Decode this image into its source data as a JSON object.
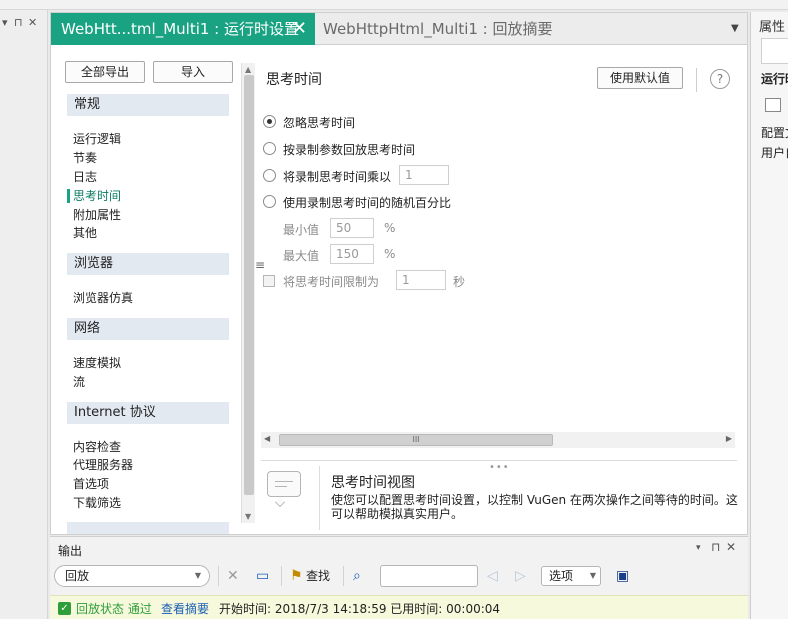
{
  "window": {
    "left_panel_controls": [
      "▾",
      "⊓",
      "✕"
    ]
  },
  "tabs": [
    {
      "label": "WebHtt...tml_Multi1 : 运行时设置",
      "active": true,
      "close": "✕"
    },
    {
      "label": "WebHttpHtml_Multi1 : 回放摘要",
      "active": false
    }
  ],
  "left_panel": {
    "buttons": {
      "export_all": "全部导出",
      "import": "导入"
    },
    "categories": [
      {
        "header": "常规",
        "items": [
          "运行逻辑",
          "节奏",
          "日志",
          "思考时间",
          "附加属性",
          "其他"
        ]
      },
      {
        "header": "浏览器",
        "items": [
          "浏览器仿真"
        ]
      },
      {
        "header": "网络",
        "items": [
          "速度模拟",
          "流"
        ]
      },
      {
        "header": "Internet 协议",
        "items": [
          "内容检查",
          "代理服务器",
          "首选项",
          "下载筛选"
        ]
      }
    ],
    "selected_item": "思考时间",
    "splitter_glyph": "≡"
  },
  "settings": {
    "title": "思考时间",
    "use_default_button": "使用默认值",
    "help": "?",
    "options": [
      {
        "label": "忽略思考时间",
        "selected": true
      },
      {
        "label": "按录制参数回放思考时间",
        "selected": false
      },
      {
        "label": "将录制思考时间乘以",
        "selected": false,
        "value": "1"
      },
      {
        "label": "使用录制思考时间的随机百分比",
        "selected": false
      }
    ],
    "min": {
      "label": "最小值",
      "value": "50",
      "unit": "%"
    },
    "max": {
      "label": "最大值",
      "value": "150",
      "unit": "%"
    },
    "limit": {
      "label": "将思考时间限制为",
      "value": "1",
      "unit": "秒",
      "checked": false
    },
    "scroll_thumb_glyph": "III",
    "grip_glyph": "•••"
  },
  "info": {
    "title": "思考时间视图",
    "text": "使您可以配置思考时间设置，以控制 VuGen 在两次操作之间等待的时间。这可以帮助模拟真实用户。"
  },
  "properties": {
    "title": "属性",
    "rows": [
      "运行时",
      "配置文",
      "用户自"
    ]
  },
  "output": {
    "title": "输出",
    "controls": [
      "▾",
      "⊓",
      "✕"
    ],
    "combo_value": "回放",
    "find_label": "查找",
    "options_label": "选项",
    "status": {
      "state_label": "回放状态 通过",
      "summary_link": "查看摘要",
      "timing": "开始时间: 2018/7/3 14:18:59 已用时间: 00:00:04"
    }
  },
  "colors": {
    "accent": "#1aa383",
    "status_green": "#2e9e3a",
    "link_blue": "#1a5fb4",
    "status_bg": "#f7f9dc"
  }
}
